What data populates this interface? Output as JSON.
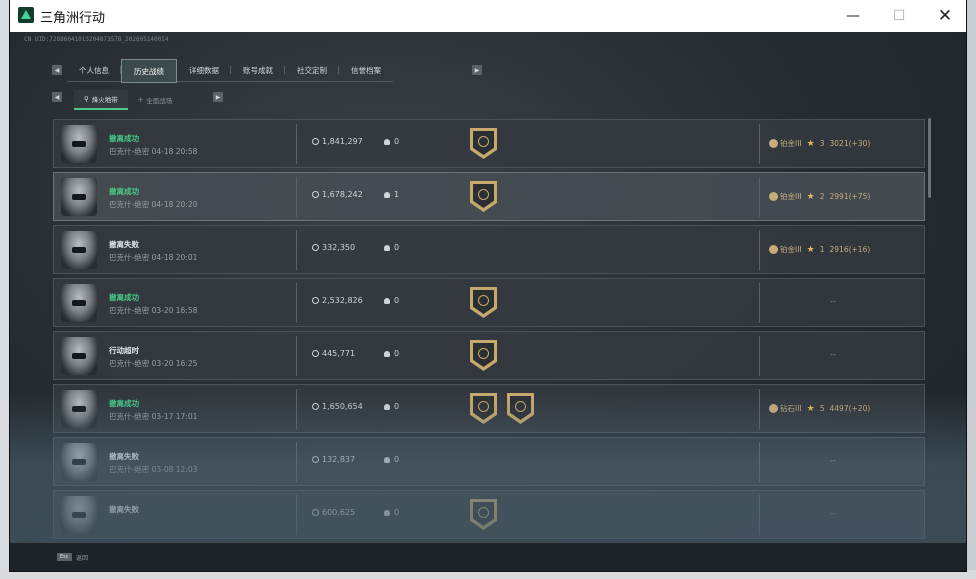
{
  "window": {
    "title": "三角洲行动",
    "minimize": "—",
    "maximize": "☐",
    "close": "✕"
  },
  "uid": "CN UID:7288604101320487357B_2026051400I4",
  "tabs": [
    "个人信息",
    "历史战绩",
    "详细数据",
    "账号成就",
    "社交定制",
    "信誉档案"
  ],
  "active_tab": "历史战绩",
  "subtabs": [
    "烽火地带",
    "全面战场"
  ],
  "matches": [
    {
      "status": "撤离成功",
      "success": true,
      "map_date": "巴克什-绝密 04-18 20:58",
      "money": "1,841,297",
      "kills": "0",
      "badges": 1,
      "rank_name": "铂金III",
      "stars": "3",
      "score": "3021(+30)"
    },
    {
      "status": "撤离成功",
      "success": true,
      "map_date": "巴克什-绝密 04-18 20:20",
      "money": "1,678,242",
      "kills": "1",
      "badges": 1,
      "rank_name": "铂金III",
      "stars": "2",
      "score": "2991(+75)"
    },
    {
      "status": "撤离失败",
      "success": false,
      "map_date": "巴克什-绝密 04-18 20:01",
      "money": "332,350",
      "kills": "0",
      "badges": 0,
      "rank_name": "铂金III",
      "stars": "1",
      "score": "2916(+16)"
    },
    {
      "status": "撤离成功",
      "success": true,
      "map_date": "巴克什-绝密 03-20 16:58",
      "money": "2,532,826",
      "kills": "0",
      "badges": 1,
      "rank_name": "",
      "stars": "",
      "score": "--"
    },
    {
      "status": "行动超时",
      "success": false,
      "map_date": "巴克什-绝密 03-20 16:25",
      "money": "445,771",
      "kills": "0",
      "badges": 1,
      "rank_name": "",
      "stars": "",
      "score": "--"
    },
    {
      "status": "撤离成功",
      "success": true,
      "map_date": "巴克什-绝密 03-17 17:01",
      "money": "1,650,654",
      "kills": "0",
      "badges": 2,
      "rank_name": "钻石III",
      "stars": "5",
      "score": "4497(+20)"
    },
    {
      "status": "撤离失败",
      "success": false,
      "map_date": "巴克什-绝密 03-08 12:03",
      "money": "132,837",
      "kills": "0",
      "badges": 0,
      "rank_name": "",
      "stars": "",
      "score": "--"
    },
    {
      "status": "撤离失败",
      "success": false,
      "map_date": "",
      "money": "600,625",
      "kills": "0",
      "badges": 1,
      "rank_name": "",
      "stars": "",
      "score": "--"
    }
  ],
  "footer": {
    "esc_key": "Esc",
    "esc_label": "返回"
  },
  "colors": {
    "success": "#47c986",
    "rank": "#c7ad7c",
    "badge_gold": "#c7a96d"
  }
}
